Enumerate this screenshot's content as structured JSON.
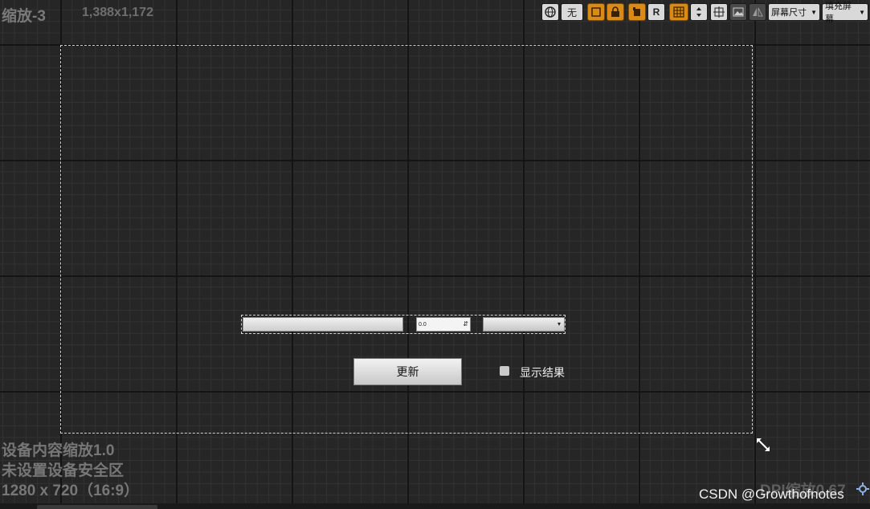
{
  "header": {
    "zoom_label": "缩放-3",
    "resolution": "1,388x1,172"
  },
  "toolbar": {
    "localization_icon": "globe-icon",
    "language_label": "无",
    "r_label": "R",
    "screen_size_label": "屏幕尺寸",
    "fill_screen_label": "填充屏幕"
  },
  "widgets": {
    "spin_value": "0.0",
    "update_button_label": "更新",
    "checkbox_label": "显示结果"
  },
  "footer": {
    "content_scale": "设备内容缩放1.0",
    "safe_zone": "未设置设备安全区",
    "resolution_ratio": "1280 x 720（16:9）",
    "dpi_scale": "DPI缩放0.67",
    "watermark": "CSDN @Growthofnotes"
  },
  "colors": {
    "accent_orange": "#d98a17",
    "background": "#262626"
  }
}
